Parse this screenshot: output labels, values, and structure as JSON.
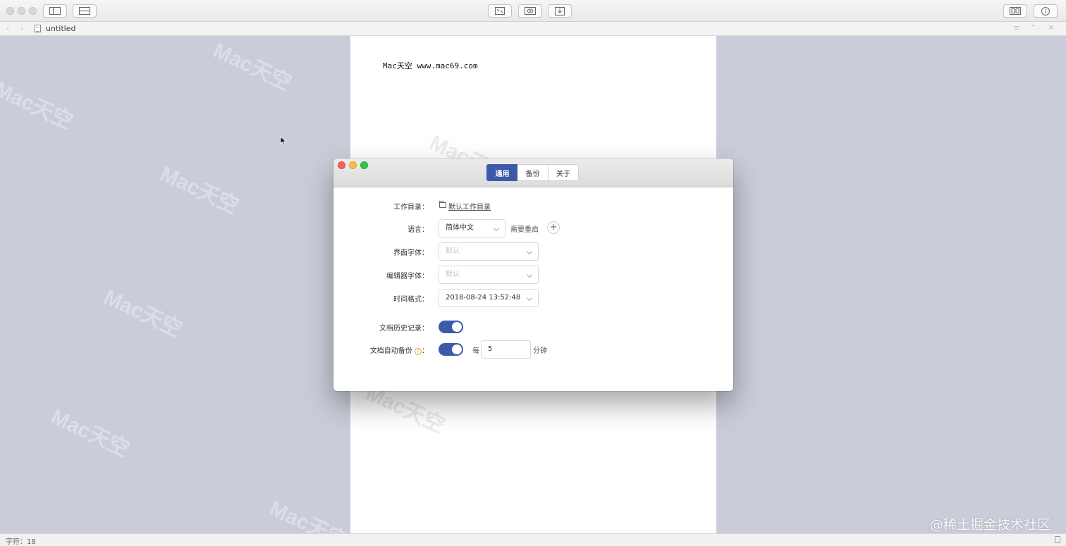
{
  "window": {
    "tab_title": "untitled",
    "page_content": "Mac天空 www.mac69.com",
    "status_label": "字符：18",
    "corner_watermark": "@稀土掘金技术社区",
    "bg_watermark": "Mac天空",
    "toolbar_icons": [
      "sidebar-toggle-icon",
      "layout-icon",
      "fullscreen-icon",
      "preview-eye-icon",
      "export-icon",
      "split-view-icon",
      "info-icon"
    ]
  },
  "dialog": {
    "tabs": [
      {
        "label": "通用",
        "active": true
      },
      {
        "label": "备份",
        "active": false
      },
      {
        "label": "关于",
        "active": false
      }
    ],
    "workdir": {
      "label": "工作目录：",
      "value": "默认工作目录"
    },
    "language": {
      "label": "语言：",
      "value": "简体中文",
      "hint": "需要重启",
      "add": "+"
    },
    "ui_font": {
      "label": "界面字体：",
      "value": "默认"
    },
    "editor_font": {
      "label": "编辑器字体：",
      "value": "默认"
    },
    "time_format": {
      "label": "时间格式：",
      "value": "2018-08-24 13:52:48"
    },
    "doc_history": {
      "label": "文档历史记录：",
      "on": true
    },
    "auto_backup": {
      "label": "文档自动备份",
      "colon": "：",
      "info": "!",
      "on": true,
      "every": "每",
      "interval": "5",
      "unit": "分钟"
    }
  },
  "colors": {
    "accent": "#3d5aa8",
    "page_bg": "#c9cdd9"
  }
}
